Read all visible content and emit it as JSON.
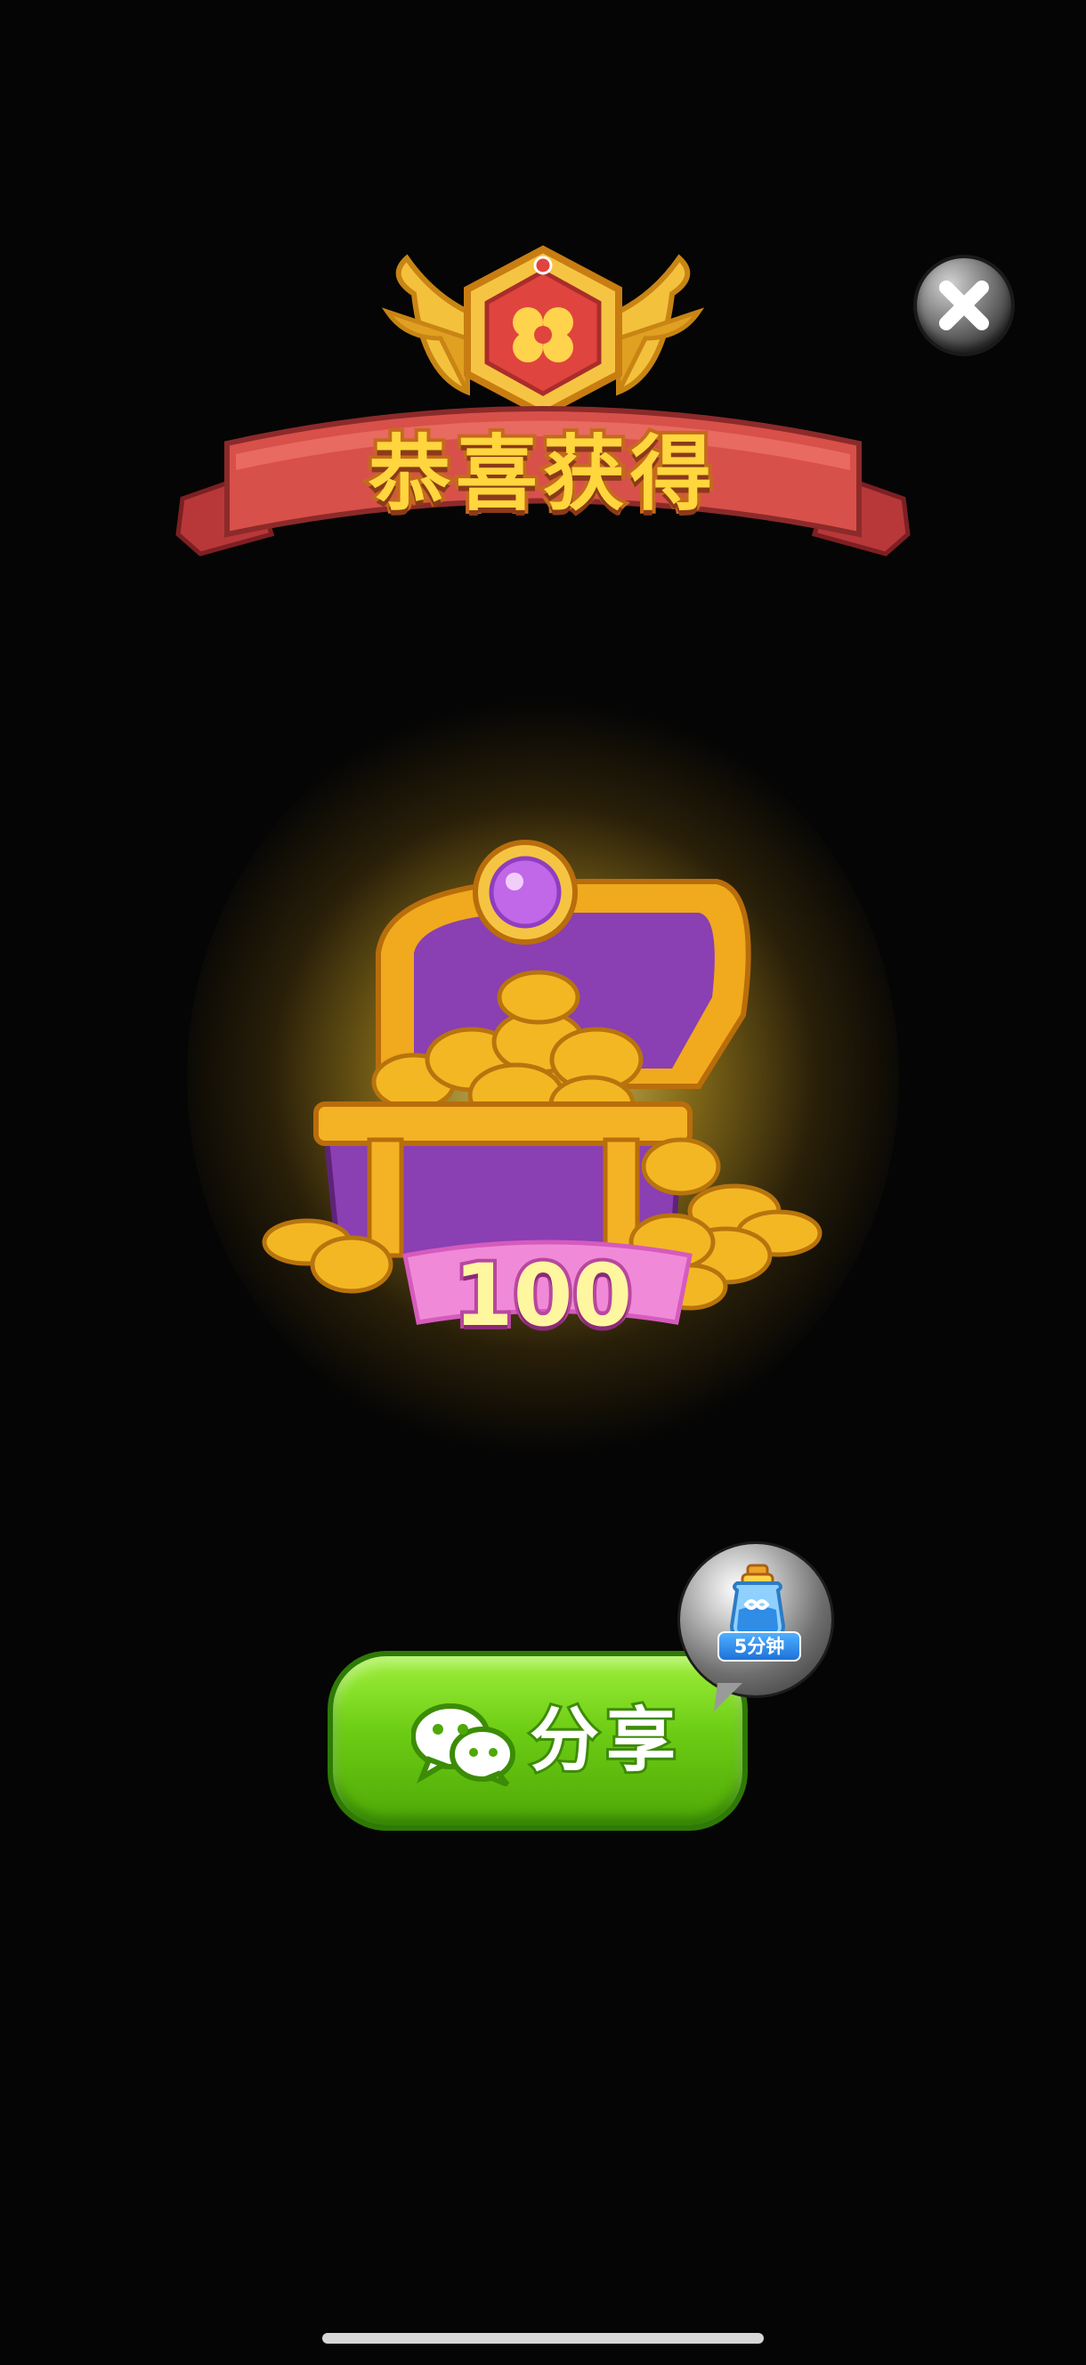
{
  "dialog": {
    "title": "恭喜获得",
    "reward_amount": "100",
    "reward_icon": "treasure-chest-icon",
    "emblem_icon": "clover-badge-icon",
    "close_icon": "close-icon"
  },
  "share": {
    "label": "分享",
    "icon": "wechat-icon"
  },
  "bonus_bubble": {
    "label": "5分钟",
    "icon": "infinite-potion-icon"
  },
  "colors": {
    "background": "#050505",
    "banner_red": "#d8504a",
    "title_gold": "#ffd63d",
    "button_green": "#6ccc14",
    "ribbon_pink": "#f08ad8"
  }
}
